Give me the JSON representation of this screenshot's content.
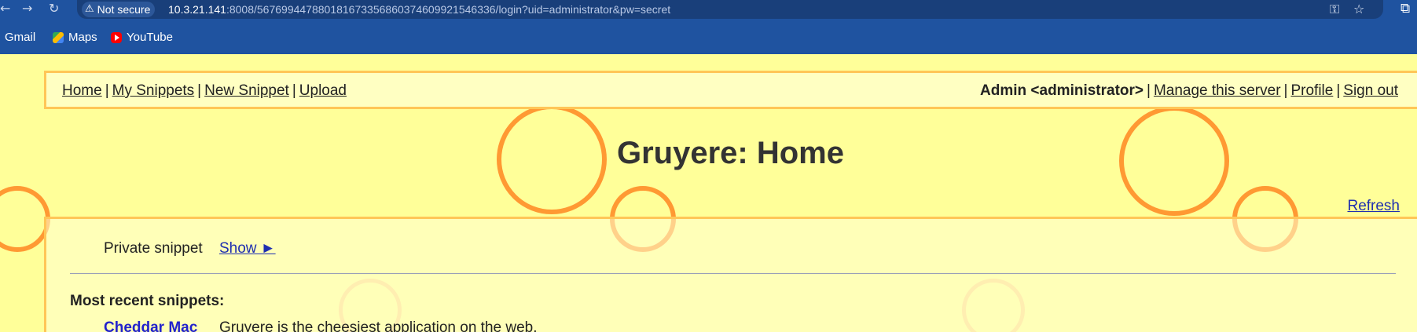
{
  "browser": {
    "security_label": "Not secure",
    "url_host": "10.3.21.141",
    "url_rest": ":8008/567699447880181673356860374609921546336/login?uid=administrator&pw=secret",
    "bookmarks": [
      {
        "label": "Gmail",
        "icon": "gmail-icon"
      },
      {
        "label": "Maps",
        "icon": "maps-icon"
      },
      {
        "label": "YouTube",
        "icon": "youtube-icon"
      }
    ]
  },
  "menu": {
    "left": [
      "Home",
      "My Snippets",
      "New Snippet",
      "Upload"
    ],
    "user_label": "Admin <administrator>",
    "right": [
      "Manage this server",
      "Profile",
      "Sign out"
    ]
  },
  "page": {
    "title": "Gruyere: Home",
    "refresh_label": "Refresh",
    "private_label": "Private snippet",
    "show_label": "Show ►",
    "recent_heading": "Most recent snippets:",
    "snippets": [
      {
        "author": "Cheddar Mac",
        "text": "Gruyere is the cheesiest application on the web."
      }
    ]
  },
  "colors": {
    "chrome_bg": "#1f53a0",
    "page_bg": "#ffff99",
    "panel_border": "#ffc657",
    "circle_orange": "#ff9933",
    "link_blue": "#1f2fb0"
  }
}
